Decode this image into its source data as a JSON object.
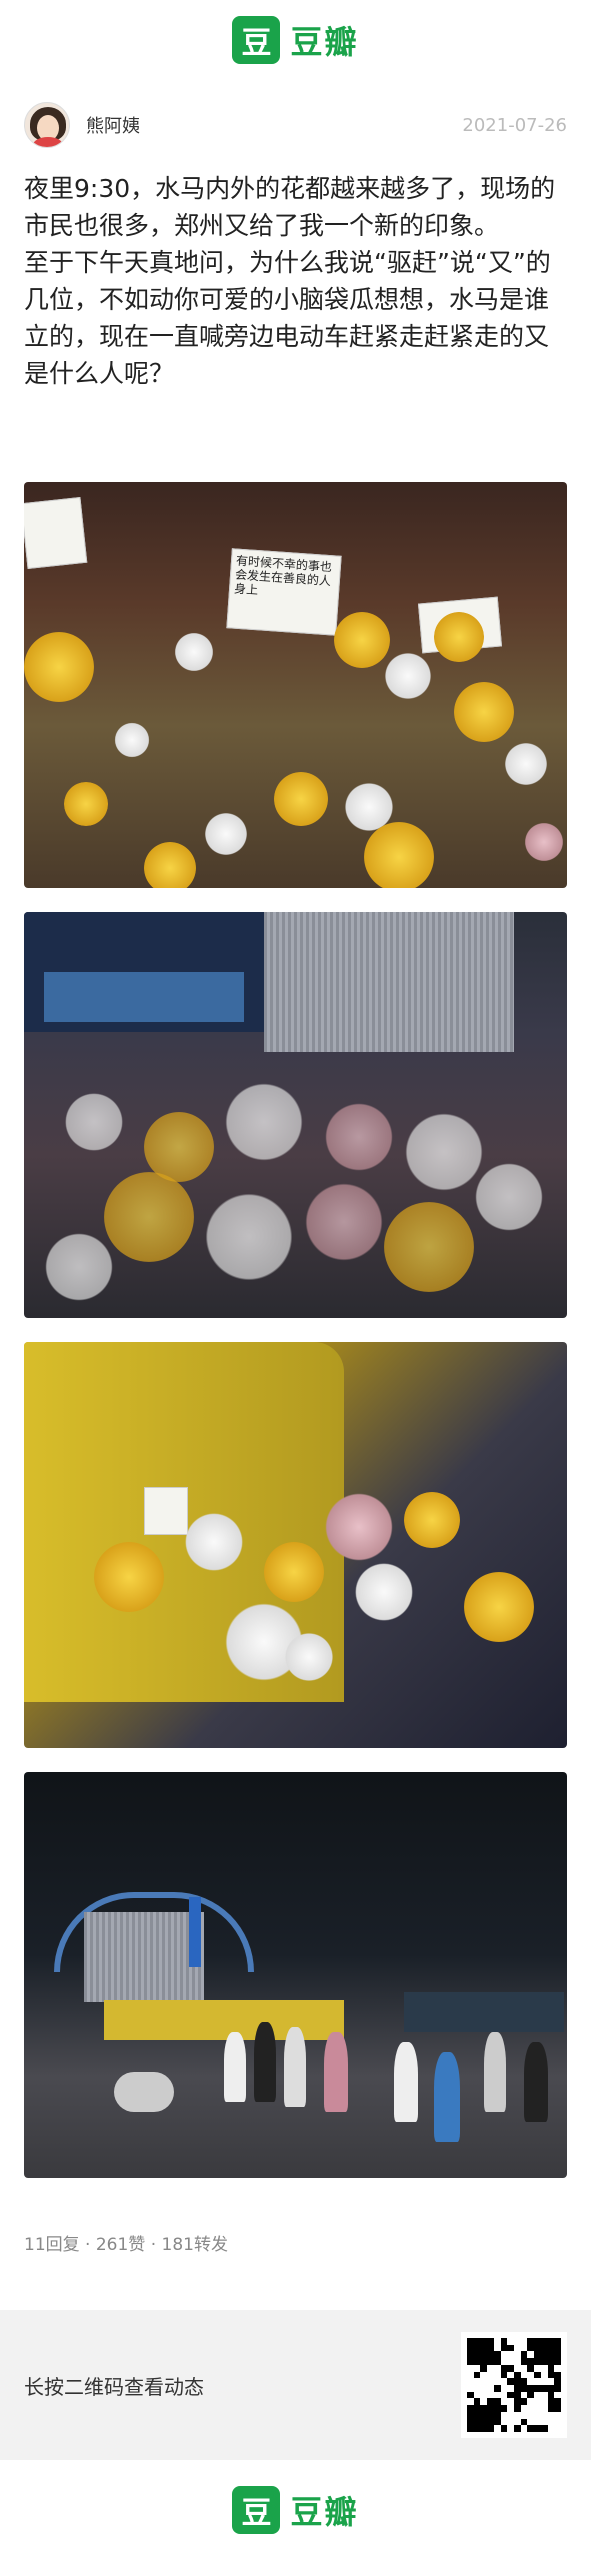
{
  "header": {
    "logo_mark": "豆",
    "logo_text": "豆瓣"
  },
  "author": {
    "name": "熊阿姨",
    "date": "2021-07-26",
    "avatar_icon": "avatar-icon"
  },
  "post": {
    "paragraphs": [
      "夜里9:30，水马内外的花都越来越多了，现场的市民也很多，郑州又给了我一个新的印象。",
      "至于下午天真地问，为什么我说“驱赶”说“又”的几位，不如动你可爱的小脑袋瓜想想，水马是谁立的，现在一直喊旁边电动车赶紧走赶紧走的又是什么人呢？"
    ]
  },
  "photos": {
    "p1_card_left": "",
    "p1_card_mid": "有时候不幸的事也会发生在善良的人身上",
    "p1_card_right": ""
  },
  "stats": "11回复 · 261赞 · 181转发",
  "qr": {
    "text": "长按二维码查看动态"
  },
  "footer": {
    "logo_mark": "豆",
    "logo_text": "豆瓣"
  },
  "colors": {
    "brand": "#1aa34a",
    "date": "#bbbbbb",
    "stats": "#888888"
  }
}
